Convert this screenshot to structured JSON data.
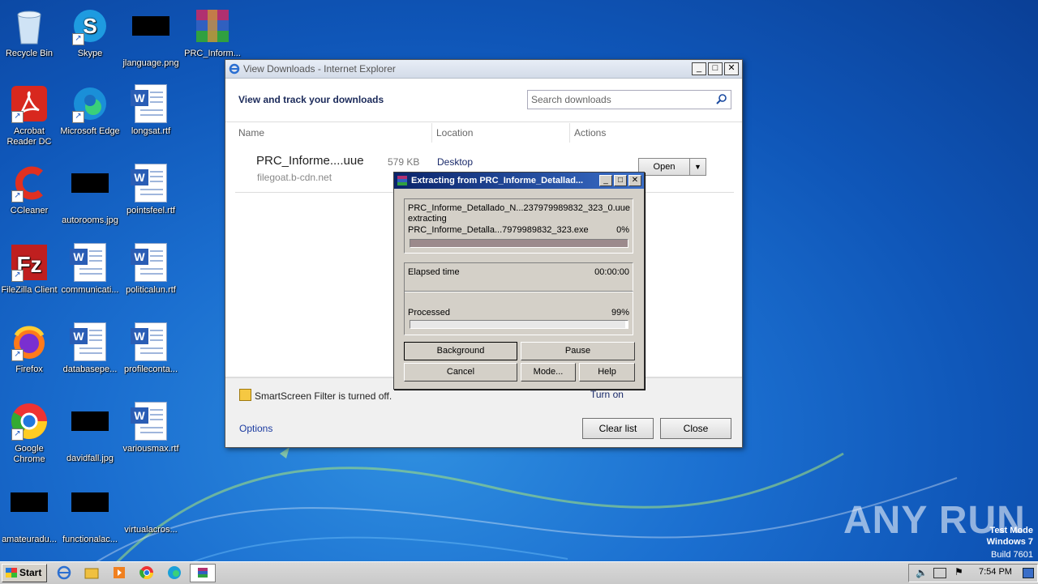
{
  "desktop": {
    "icons": [
      {
        "label": "Recycle Bin",
        "icon": "recycle-bin-icon"
      },
      {
        "label": "Skype",
        "icon": "skype-icon"
      },
      {
        "label": "jlanguage.png",
        "icon": "image-file-icon"
      },
      {
        "label": "PRC_Inform...",
        "icon": "winrar-icon"
      },
      {
        "label": "Acrobat Reader DC",
        "icon": "acrobat-icon"
      },
      {
        "label": "Microsoft Edge",
        "icon": "edge-icon"
      },
      {
        "label": "longsat.rtf",
        "icon": "word-doc-icon"
      },
      {
        "label": "CCleaner",
        "icon": "ccleaner-icon"
      },
      {
        "label": "autorooms.jpg",
        "icon": "image-file-icon"
      },
      {
        "label": "pointsfeel.rtf",
        "icon": "word-doc-icon"
      },
      {
        "label": "FileZilla Client",
        "icon": "filezilla-icon"
      },
      {
        "label": "communicati...",
        "icon": "word-doc-icon"
      },
      {
        "label": "politicalun.rtf",
        "icon": "word-doc-icon"
      },
      {
        "label": "Firefox",
        "icon": "firefox-icon"
      },
      {
        "label": "databasepe...",
        "icon": "word-doc-icon"
      },
      {
        "label": "profileconta...",
        "icon": "word-doc-icon"
      },
      {
        "label": "Google Chrome",
        "icon": "chrome-icon"
      },
      {
        "label": "davidfall.jpg",
        "icon": "image-file-icon"
      },
      {
        "label": "variousmax.rtf",
        "icon": "word-doc-icon"
      },
      {
        "label": "amateuradu...",
        "icon": "image-file-icon"
      },
      {
        "label": "functionalac...",
        "icon": "image-file-icon"
      },
      {
        "label": "virtualacros..."
      }
    ]
  },
  "ie_window": {
    "title": "View Downloads - Internet Explorer",
    "heading": "View and track your downloads",
    "search_placeholder": "Search downloads",
    "columns": [
      "Name",
      "Location",
      "Actions"
    ],
    "download": {
      "name": "PRC_Informe....uue",
      "size": "579 KB",
      "location": "Desktop",
      "source": "filegoat.b-cdn.net",
      "action": "Open"
    },
    "smartscreen": "SmartScreen Filter is turned off.",
    "turn_on": "Turn on",
    "options": "Options",
    "clear_list": "Clear list",
    "close": "Close"
  },
  "rar_dialog": {
    "title": "Extracting from PRC_Informe_Detallad...",
    "archive": "PRC_Informe_Detallado_N...237979989832_323_0.uue",
    "action": "extracting",
    "file": "PRC_Informe_Detalla...7979989832_323.exe",
    "file_percent": "0%",
    "file_progress": 1.0,
    "elapsed_label": "Elapsed time",
    "elapsed_value": "00:00:00",
    "processed_label": "Processed",
    "processed_percent": "99%",
    "processed_progress": 0.99,
    "buttons": {
      "background": "Background",
      "pause": "Pause",
      "cancel": "Cancel",
      "mode": "Mode...",
      "help": "Help"
    }
  },
  "taskbar": {
    "start": "Start",
    "clock": "7:54 PM"
  },
  "watermark": "ANY RUN",
  "test_mode": {
    "line1": "Test Mode",
    "line2": "Windows 7",
    "line3": "Build 7601"
  }
}
